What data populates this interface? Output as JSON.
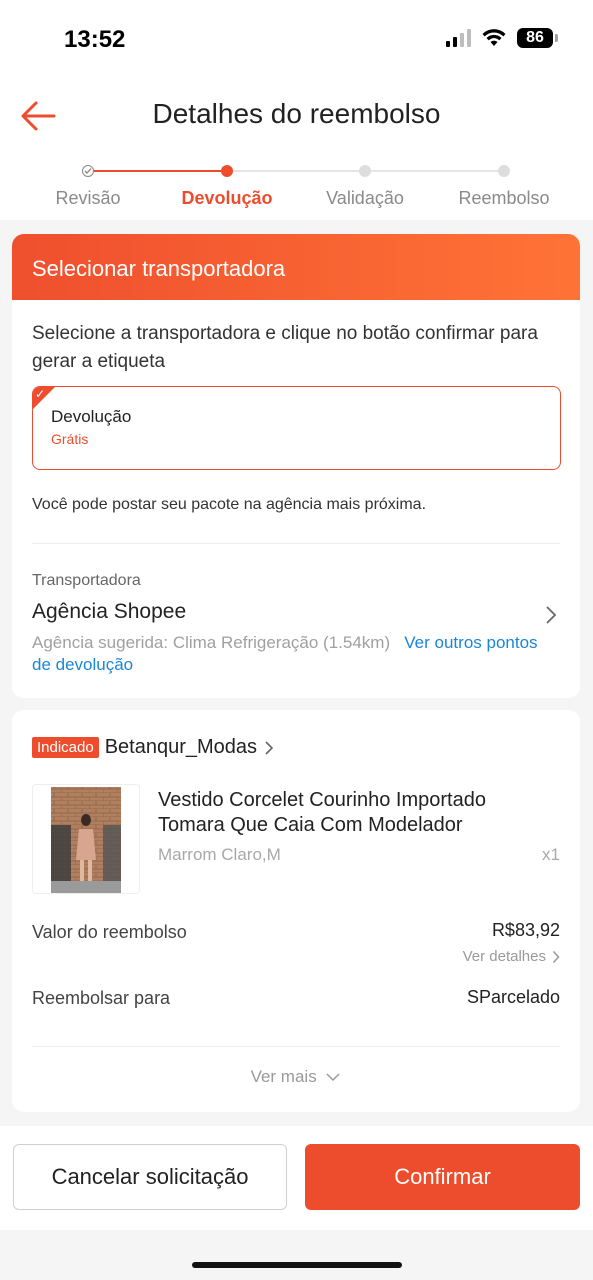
{
  "status_bar": {
    "time": "13:52",
    "battery": "86"
  },
  "header": {
    "title": "Detalhes do reembolso"
  },
  "stepper": {
    "steps": [
      {
        "label": "Revisão",
        "state": "done"
      },
      {
        "label": "Devolução",
        "state": "active"
      },
      {
        "label": "Validação",
        "state": "pending"
      },
      {
        "label": "Reembolso",
        "state": "pending"
      }
    ]
  },
  "carrier_card": {
    "banner": "Selecionar transportadora",
    "instruction": "Selecione a transportadora e clique no botão confirmar para gerar a etiqueta",
    "option": {
      "title": "Devolução",
      "subtitle": "Grátis",
      "selected": true
    },
    "post_note": "Você pode postar seu pacote na agência mais próxima.",
    "carrier_label": "Transportadora",
    "carrier_name": "Agência Shopee",
    "suggestion": "Agência sugerida: Clima Refrigeração (1.54km)",
    "suggestion_link": "Ver outros pontos de devolução"
  },
  "order_card": {
    "badge": "Indicado",
    "shop_name": "Betanqur_Modas",
    "product": {
      "title": "Vestido Corcelet Courinho Importado Tomara Que Caia Com Modelador",
      "variant": "Marrom Claro,M",
      "quantity": "x1"
    },
    "refund_label": "Valor do reembolso",
    "refund_value": "R$83,92",
    "details_link": "Ver detalhes",
    "refund_to_label": "Reembolsar para",
    "refund_to_value": "SParcelado",
    "more": "Ver mais"
  },
  "actions": {
    "cancel": "Cancelar solicitação",
    "confirm": "Confirmar"
  },
  "colors": {
    "accent": "#ee4d2d",
    "link": "#1a86d8"
  }
}
